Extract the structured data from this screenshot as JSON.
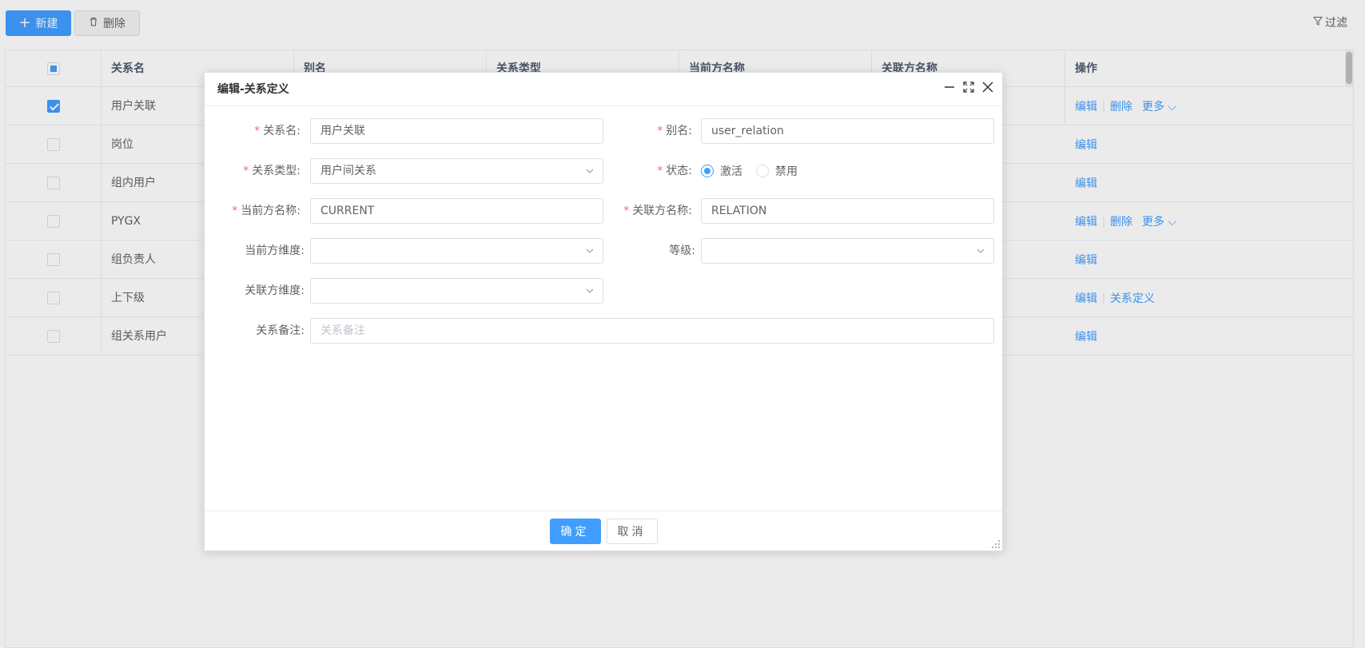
{
  "toolbar": {
    "new_label": "新建",
    "delete_label": "删除",
    "filter_label": "过滤"
  },
  "table": {
    "headers": [
      "关系名",
      "别名",
      "关系类型",
      "当前方名称",
      "关联方名称",
      "操作"
    ],
    "rows": [
      {
        "name": "用户关联",
        "checked": true,
        "ops": [
          "编辑",
          "删除",
          "更多"
        ]
      },
      {
        "name": "岗位",
        "checked": false,
        "ops": [
          "编辑"
        ]
      },
      {
        "name": "组内用户",
        "checked": false,
        "ops": [
          "编辑"
        ]
      },
      {
        "name": "PYGX",
        "checked": false,
        "ops": [
          "编辑",
          "删除",
          "更多"
        ]
      },
      {
        "name": "组负责人",
        "checked": false,
        "ops": [
          "编辑"
        ]
      },
      {
        "name": "上下级",
        "checked": false,
        "ops": [
          "编辑",
          "关系定义"
        ]
      },
      {
        "name": "组关系用户",
        "checked": false,
        "ops": [
          "编辑"
        ]
      }
    ]
  },
  "modal": {
    "title": "编辑-关系定义",
    "fields": {
      "name_label": "关系名:",
      "name_value": "用户关联",
      "alias_label": "别名:",
      "alias_value": "user_relation",
      "type_label": "关系类型:",
      "type_value": "用户间关系",
      "status_label": "状态:",
      "status_active": "激活",
      "status_disabled": "禁用",
      "current_name_label": "当前方名称:",
      "current_name_value": "CURRENT",
      "related_name_label": "关联方名称:",
      "related_name_value": "RELATION",
      "current_dim_label": "当前方维度:",
      "level_label": "等级:",
      "related_dim_label": "关联方维度:",
      "remark_label": "关系备注:",
      "remark_placeholder": "关系备注"
    },
    "ok_label": "确定",
    "cancel_label": "取消"
  },
  "colors": {
    "primary": "#409eff",
    "required": "#f56c6c"
  }
}
